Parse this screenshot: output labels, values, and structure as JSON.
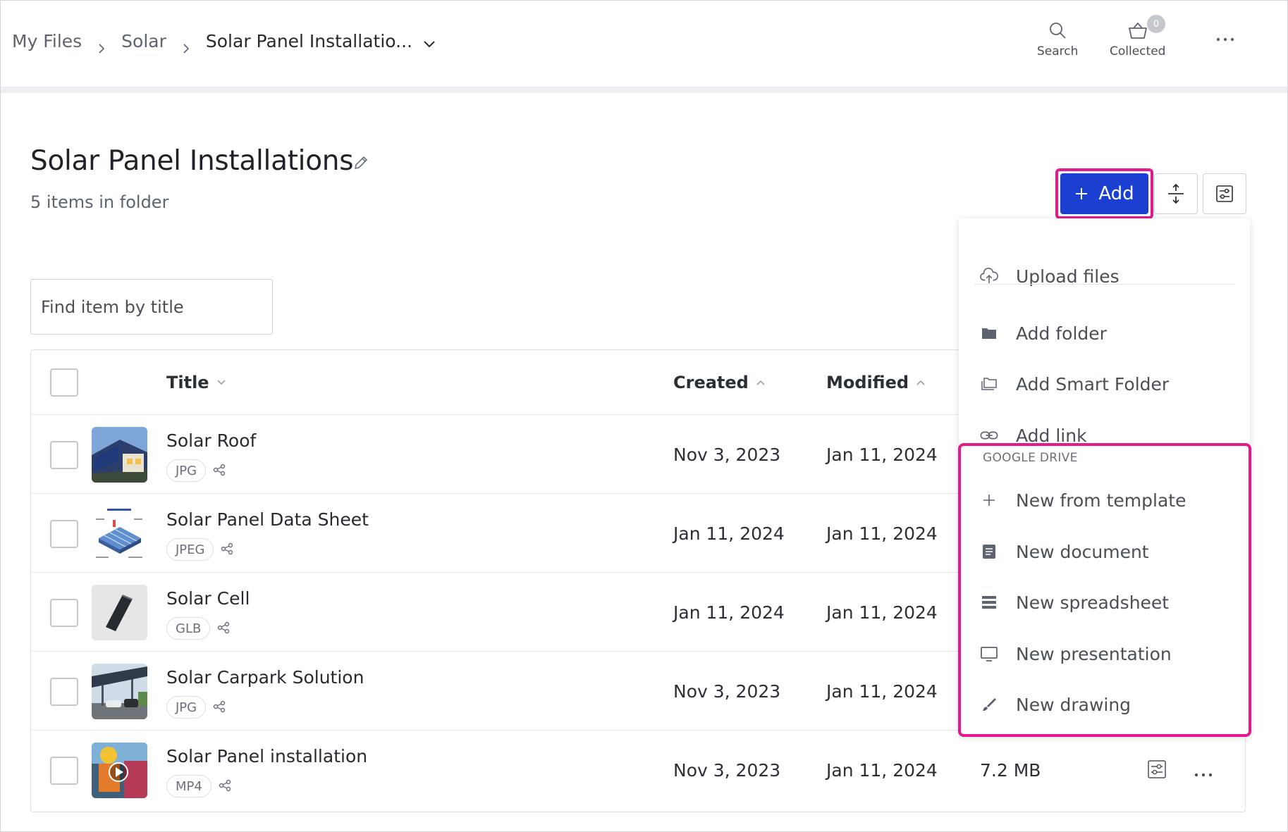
{
  "breadcrumb": {
    "items": [
      "My Files",
      "Solar"
    ],
    "current": "Solar Panel Installatio..."
  },
  "header_tools": {
    "search_label": "Search",
    "collected_label": "Collected",
    "collected_count": "0"
  },
  "folder": {
    "title": "Solar Panel Installations",
    "item_count": "5 items in folder"
  },
  "toolbar": {
    "add_label": "Add"
  },
  "search": {
    "placeholder": "Find item by title"
  },
  "table": {
    "columns": {
      "title": "Title",
      "created": "Created",
      "modified": "Modified"
    },
    "rows": [
      {
        "title": "Solar Roof",
        "type": "JPG",
        "created": "Nov 3, 2023",
        "modified": "Jan 11, 2024",
        "size": ""
      },
      {
        "title": "Solar Panel Data Sheet",
        "type": "JPEG",
        "created": "Jan 11, 2024",
        "modified": "Jan 11, 2024",
        "size": ""
      },
      {
        "title": "Solar Cell",
        "type": "GLB",
        "created": "Jan 11, 2024",
        "modified": "Jan 11, 2024",
        "size": ""
      },
      {
        "title": "Solar Carpark Solution",
        "type": "JPG",
        "created": "Nov 3, 2023",
        "modified": "Jan 11, 2024",
        "size": ""
      },
      {
        "title": "Solar Panel installation",
        "type": "MP4",
        "created": "Nov 3, 2023",
        "modified": "Jan 11, 2024",
        "size": "7.2 MB"
      }
    ]
  },
  "add_menu": {
    "upload_files": "Upload files",
    "add_folder": "Add folder",
    "add_smart_folder": "Add Smart Folder",
    "add_link": "Add link",
    "google_drive": {
      "title": "GOOGLE DRIVE",
      "items": [
        "New from template",
        "New document",
        "New spreadsheet",
        "New presentation",
        "New drawing"
      ]
    }
  },
  "colors": {
    "primary": "#1b3fd1",
    "highlight": "#e6188c"
  }
}
